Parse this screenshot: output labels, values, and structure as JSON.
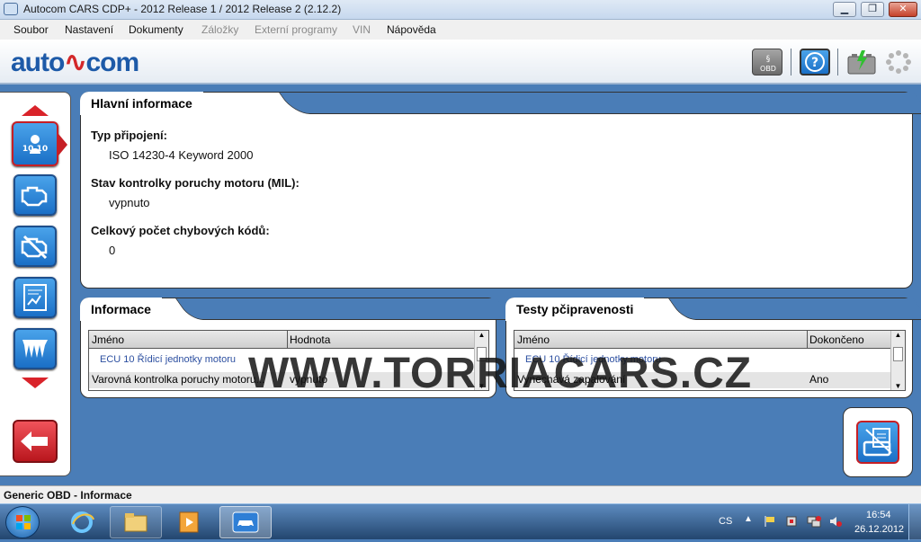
{
  "window": {
    "title": "Autocom CARS CDP+ - 2012 Release 1 / 2012 Release 2 (2.12.2)",
    "btn_min": "▁",
    "btn_max": "❐",
    "btn_close": "✕"
  },
  "menu": {
    "items": [
      {
        "label": "Soubor",
        "enabled": true
      },
      {
        "label": "Nastavení",
        "enabled": true
      },
      {
        "label": "Dokumenty",
        "enabled": true
      },
      {
        "label": "Záložky",
        "enabled": false
      },
      {
        "label": "Externí programy",
        "enabled": false
      },
      {
        "label": "VIN",
        "enabled": false
      },
      {
        "label": "Nápověda",
        "enabled": true
      }
    ]
  },
  "header": {
    "logo_left": "auto",
    "logo_right": "com",
    "buttons": [
      "obd-law-icon",
      "help-icon",
      "battery-icon",
      "loading-spinner-icon"
    ]
  },
  "nav": {
    "buttons": [
      "info-icon",
      "engine-icon",
      "engine-fault-icon",
      "chart-icon",
      "sensor-icon"
    ],
    "active_index": 0,
    "info_badge": "10 10"
  },
  "main": {
    "title": "Hlavní informace",
    "connection_type_label": "Typ připojení:",
    "connection_type_value": "ISO 14230-4 Keyword 2000",
    "mil_label": "Stav kontrolky poruchy motoru (MIL):",
    "mil_value": "vypnuto",
    "dtc_count_label": "Celkový počet chybových kódů:",
    "dtc_count_value": "0"
  },
  "info_panel": {
    "title": "Informace",
    "col_name": "Jméno",
    "col_value": "Hodnota",
    "group_row": "ECU 10 Řídicí jednotky motoru",
    "row_name": "Varovná kontrolka poruchy motoru...",
    "row_value": "vypnuto"
  },
  "tests_panel": {
    "title": "Testy pčipravenosti",
    "col_name": "Jméno",
    "col_done": "Dokončeno",
    "group_row": "ECU 10 Řídicí jednotky motoru",
    "row_name": "Vynechává zapalování",
    "row_done": "Ano"
  },
  "watermark": "WWW.TORRIACARS.CZ",
  "statusbar": {
    "text": "Generic OBD - Informace"
  },
  "taskbar": {
    "language": "CS",
    "time": "16:54",
    "date": "26.12.2012"
  },
  "colors": {
    "background": "#4a7db7",
    "accent_blue": "#1a6fc6",
    "accent_red": "#d9232a"
  }
}
